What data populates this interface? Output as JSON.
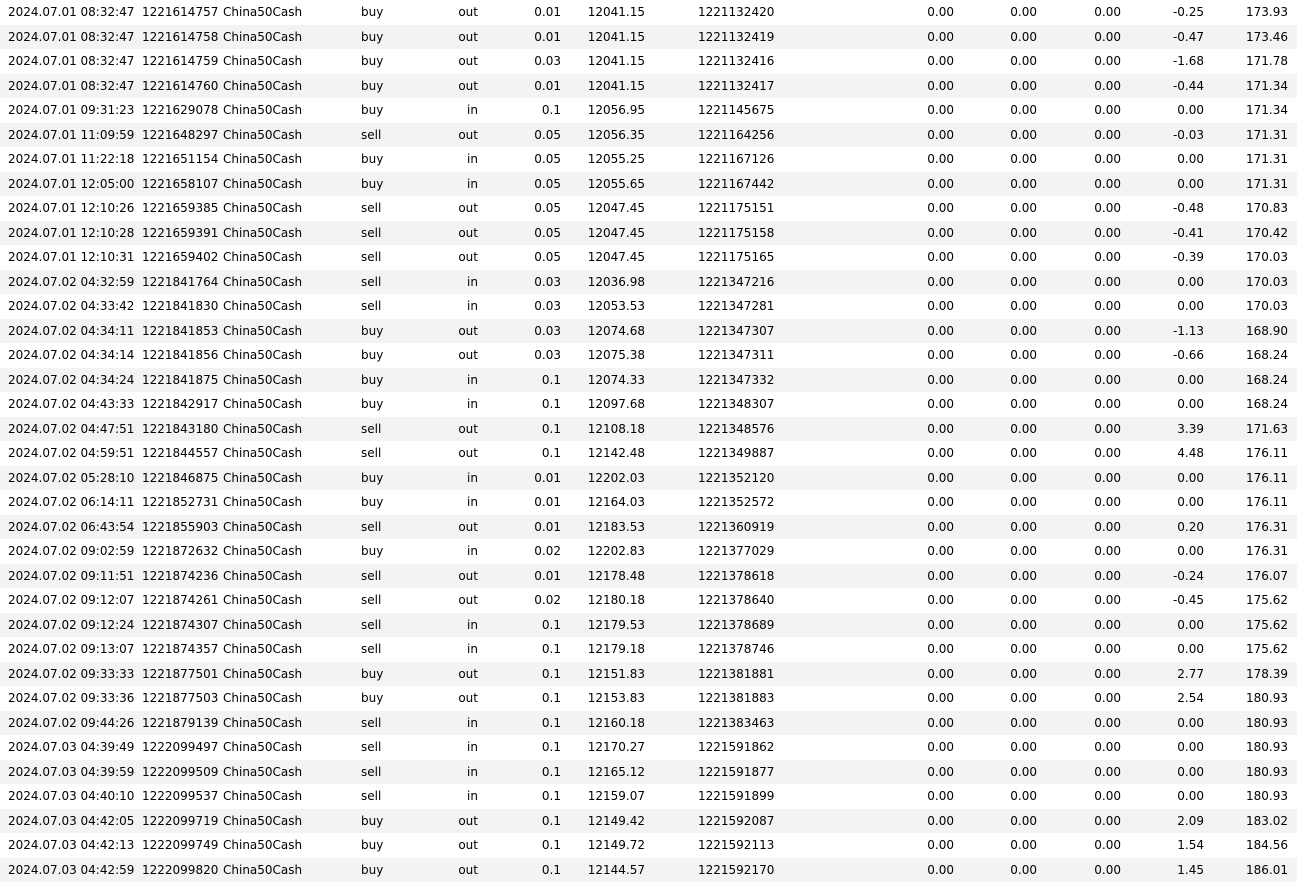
{
  "table": {
    "rows": [
      {
        "time": "2024.07.01 08:32:47",
        "deal": "1221614757",
        "symbol": "China50Cash",
        "type": "buy",
        "direction": "out",
        "volume": "0.01",
        "price": "12041.15",
        "order": "1221132420",
        "commission": "0.00",
        "fee": "0.00",
        "swap": "0.00",
        "profit": "-0.25",
        "balance": "173.93"
      },
      {
        "time": "2024.07.01 08:32:47",
        "deal": "1221614758",
        "symbol": "China50Cash",
        "type": "buy",
        "direction": "out",
        "volume": "0.01",
        "price": "12041.15",
        "order": "1221132419",
        "commission": "0.00",
        "fee": "0.00",
        "swap": "0.00",
        "profit": "-0.47",
        "balance": "173.46"
      },
      {
        "time": "2024.07.01 08:32:47",
        "deal": "1221614759",
        "symbol": "China50Cash",
        "type": "buy",
        "direction": "out",
        "volume": "0.03",
        "price": "12041.15",
        "order": "1221132416",
        "commission": "0.00",
        "fee": "0.00",
        "swap": "0.00",
        "profit": "-1.68",
        "balance": "171.78"
      },
      {
        "time": "2024.07.01 08:32:47",
        "deal": "1221614760",
        "symbol": "China50Cash",
        "type": "buy",
        "direction": "out",
        "volume": "0.01",
        "price": "12041.15",
        "order": "1221132417",
        "commission": "0.00",
        "fee": "0.00",
        "swap": "0.00",
        "profit": "-0.44",
        "balance": "171.34"
      },
      {
        "time": "2024.07.01 09:31:23",
        "deal": "1221629078",
        "symbol": "China50Cash",
        "type": "buy",
        "direction": "in",
        "volume": "0.1",
        "price": "12056.95",
        "order": "1221145675",
        "commission": "0.00",
        "fee": "0.00",
        "swap": "0.00",
        "profit": "0.00",
        "balance": "171.34"
      },
      {
        "time": "2024.07.01 11:09:59",
        "deal": "1221648297",
        "symbol": "China50Cash",
        "type": "sell",
        "direction": "out",
        "volume": "0.05",
        "price": "12056.35",
        "order": "1221164256",
        "commission": "0.00",
        "fee": "0.00",
        "swap": "0.00",
        "profit": "-0.03",
        "balance": "171.31"
      },
      {
        "time": "2024.07.01 11:22:18",
        "deal": "1221651154",
        "symbol": "China50Cash",
        "type": "buy",
        "direction": "in",
        "volume": "0.05",
        "price": "12055.25",
        "order": "1221167126",
        "commission": "0.00",
        "fee": "0.00",
        "swap": "0.00",
        "profit": "0.00",
        "balance": "171.31"
      },
      {
        "time": "2024.07.01 12:05:00",
        "deal": "1221658107",
        "symbol": "China50Cash",
        "type": "buy",
        "direction": "in",
        "volume": "0.05",
        "price": "12055.65",
        "order": "1221167442",
        "commission": "0.00",
        "fee": "0.00",
        "swap": "0.00",
        "profit": "0.00",
        "balance": "171.31"
      },
      {
        "time": "2024.07.01 12:10:26",
        "deal": "1221659385",
        "symbol": "China50Cash",
        "type": "sell",
        "direction": "out",
        "volume": "0.05",
        "price": "12047.45",
        "order": "1221175151",
        "commission": "0.00",
        "fee": "0.00",
        "swap": "0.00",
        "profit": "-0.48",
        "balance": "170.83"
      },
      {
        "time": "2024.07.01 12:10:28",
        "deal": "1221659391",
        "symbol": "China50Cash",
        "type": "sell",
        "direction": "out",
        "volume": "0.05",
        "price": "12047.45",
        "order": "1221175158",
        "commission": "0.00",
        "fee": "0.00",
        "swap": "0.00",
        "profit": "-0.41",
        "balance": "170.42"
      },
      {
        "time": "2024.07.01 12:10:31",
        "deal": "1221659402",
        "symbol": "China50Cash",
        "type": "sell",
        "direction": "out",
        "volume": "0.05",
        "price": "12047.45",
        "order": "1221175165",
        "commission": "0.00",
        "fee": "0.00",
        "swap": "0.00",
        "profit": "-0.39",
        "balance": "170.03"
      },
      {
        "time": "2024.07.02 04:32:59",
        "deal": "1221841764",
        "symbol": "China50Cash",
        "type": "sell",
        "direction": "in",
        "volume": "0.03",
        "price": "12036.98",
        "order": "1221347216",
        "commission": "0.00",
        "fee": "0.00",
        "swap": "0.00",
        "profit": "0.00",
        "balance": "170.03"
      },
      {
        "time": "2024.07.02 04:33:42",
        "deal": "1221841830",
        "symbol": "China50Cash",
        "type": "sell",
        "direction": "in",
        "volume": "0.03",
        "price": "12053.53",
        "order": "1221347281",
        "commission": "0.00",
        "fee": "0.00",
        "swap": "0.00",
        "profit": "0.00",
        "balance": "170.03"
      },
      {
        "time": "2024.07.02 04:34:11",
        "deal": "1221841853",
        "symbol": "China50Cash",
        "type": "buy",
        "direction": "out",
        "volume": "0.03",
        "price": "12074.68",
        "order": "1221347307",
        "commission": "0.00",
        "fee": "0.00",
        "swap": "0.00",
        "profit": "-1.13",
        "balance": "168.90"
      },
      {
        "time": "2024.07.02 04:34:14",
        "deal": "1221841856",
        "symbol": "China50Cash",
        "type": "buy",
        "direction": "out",
        "volume": "0.03",
        "price": "12075.38",
        "order": "1221347311",
        "commission": "0.00",
        "fee": "0.00",
        "swap": "0.00",
        "profit": "-0.66",
        "balance": "168.24"
      },
      {
        "time": "2024.07.02 04:34:24",
        "deal": "1221841875",
        "symbol": "China50Cash",
        "type": "buy",
        "direction": "in",
        "volume": "0.1",
        "price": "12074.33",
        "order": "1221347332",
        "commission": "0.00",
        "fee": "0.00",
        "swap": "0.00",
        "profit": "0.00",
        "balance": "168.24"
      },
      {
        "time": "2024.07.02 04:43:33",
        "deal": "1221842917",
        "symbol": "China50Cash",
        "type": "buy",
        "direction": "in",
        "volume": "0.1",
        "price": "12097.68",
        "order": "1221348307",
        "commission": "0.00",
        "fee": "0.00",
        "swap": "0.00",
        "profit": "0.00",
        "balance": "168.24"
      },
      {
        "time": "2024.07.02 04:47:51",
        "deal": "1221843180",
        "symbol": "China50Cash",
        "type": "sell",
        "direction": "out",
        "volume": "0.1",
        "price": "12108.18",
        "order": "1221348576",
        "commission": "0.00",
        "fee": "0.00",
        "swap": "0.00",
        "profit": "3.39",
        "balance": "171.63"
      },
      {
        "time": "2024.07.02 04:59:51",
        "deal": "1221844557",
        "symbol": "China50Cash",
        "type": "sell",
        "direction": "out",
        "volume": "0.1",
        "price": "12142.48",
        "order": "1221349887",
        "commission": "0.00",
        "fee": "0.00",
        "swap": "0.00",
        "profit": "4.48",
        "balance": "176.11"
      },
      {
        "time": "2024.07.02 05:28:10",
        "deal": "1221846875",
        "symbol": "China50Cash",
        "type": "buy",
        "direction": "in",
        "volume": "0.01",
        "price": "12202.03",
        "order": "1221352120",
        "commission": "0.00",
        "fee": "0.00",
        "swap": "0.00",
        "profit": "0.00",
        "balance": "176.11"
      },
      {
        "time": "2024.07.02 06:14:11",
        "deal": "1221852731",
        "symbol": "China50Cash",
        "type": "buy",
        "direction": "in",
        "volume": "0.01",
        "price": "12164.03",
        "order": "1221352572",
        "commission": "0.00",
        "fee": "0.00",
        "swap": "0.00",
        "profit": "0.00",
        "balance": "176.11"
      },
      {
        "time": "2024.07.02 06:43:54",
        "deal": "1221855903",
        "symbol": "China50Cash",
        "type": "sell",
        "direction": "out",
        "volume": "0.01",
        "price": "12183.53",
        "order": "1221360919",
        "commission": "0.00",
        "fee": "0.00",
        "swap": "0.00",
        "profit": "0.20",
        "balance": "176.31"
      },
      {
        "time": "2024.07.02 09:02:59",
        "deal": "1221872632",
        "symbol": "China50Cash",
        "type": "buy",
        "direction": "in",
        "volume": "0.02",
        "price": "12202.83",
        "order": "1221377029",
        "commission": "0.00",
        "fee": "0.00",
        "swap": "0.00",
        "profit": "0.00",
        "balance": "176.31"
      },
      {
        "time": "2024.07.02 09:11:51",
        "deal": "1221874236",
        "symbol": "China50Cash",
        "type": "sell",
        "direction": "out",
        "volume": "0.01",
        "price": "12178.48",
        "order": "1221378618",
        "commission": "0.00",
        "fee": "0.00",
        "swap": "0.00",
        "profit": "-0.24",
        "balance": "176.07"
      },
      {
        "time": "2024.07.02 09:12:07",
        "deal": "1221874261",
        "symbol": "China50Cash",
        "type": "sell",
        "direction": "out",
        "volume": "0.02",
        "price": "12180.18",
        "order": "1221378640",
        "commission": "0.00",
        "fee": "0.00",
        "swap": "0.00",
        "profit": "-0.45",
        "balance": "175.62"
      },
      {
        "time": "2024.07.02 09:12:24",
        "deal": "1221874307",
        "symbol": "China50Cash",
        "type": "sell",
        "direction": "in",
        "volume": "0.1",
        "price": "12179.53",
        "order": "1221378689",
        "commission": "0.00",
        "fee": "0.00",
        "swap": "0.00",
        "profit": "0.00",
        "balance": "175.62"
      },
      {
        "time": "2024.07.02 09:13:07",
        "deal": "1221874357",
        "symbol": "China50Cash",
        "type": "sell",
        "direction": "in",
        "volume": "0.1",
        "price": "12179.18",
        "order": "1221378746",
        "commission": "0.00",
        "fee": "0.00",
        "swap": "0.00",
        "profit": "0.00",
        "balance": "175.62"
      },
      {
        "time": "2024.07.02 09:33:33",
        "deal": "1221877501",
        "symbol": "China50Cash",
        "type": "buy",
        "direction": "out",
        "volume": "0.1",
        "price": "12151.83",
        "order": "1221381881",
        "commission": "0.00",
        "fee": "0.00",
        "swap": "0.00",
        "profit": "2.77",
        "balance": "178.39"
      },
      {
        "time": "2024.07.02 09:33:36",
        "deal": "1221877503",
        "symbol": "China50Cash",
        "type": "buy",
        "direction": "out",
        "volume": "0.1",
        "price": "12153.83",
        "order": "1221381883",
        "commission": "0.00",
        "fee": "0.00",
        "swap": "0.00",
        "profit": "2.54",
        "balance": "180.93"
      },
      {
        "time": "2024.07.02 09:44:26",
        "deal": "1221879139",
        "symbol": "China50Cash",
        "type": "sell",
        "direction": "in",
        "volume": "0.1",
        "price": "12160.18",
        "order": "1221383463",
        "commission": "0.00",
        "fee": "0.00",
        "swap": "0.00",
        "profit": "0.00",
        "balance": "180.93"
      },
      {
        "time": "2024.07.03 04:39:49",
        "deal": "1222099497",
        "symbol": "China50Cash",
        "type": "sell",
        "direction": "in",
        "volume": "0.1",
        "price": "12170.27",
        "order": "1221591862",
        "commission": "0.00",
        "fee": "0.00",
        "swap": "0.00",
        "profit": "0.00",
        "balance": "180.93"
      },
      {
        "time": "2024.07.03 04:39:59",
        "deal": "1222099509",
        "symbol": "China50Cash",
        "type": "sell",
        "direction": "in",
        "volume": "0.1",
        "price": "12165.12",
        "order": "1221591877",
        "commission": "0.00",
        "fee": "0.00",
        "swap": "0.00",
        "profit": "0.00",
        "balance": "180.93"
      },
      {
        "time": "2024.07.03 04:40:10",
        "deal": "1222099537",
        "symbol": "China50Cash",
        "type": "sell",
        "direction": "in",
        "volume": "0.1",
        "price": "12159.07",
        "order": "1221591899",
        "commission": "0.00",
        "fee": "0.00",
        "swap": "0.00",
        "profit": "0.00",
        "balance": "180.93"
      },
      {
        "time": "2024.07.03 04:42:05",
        "deal": "1222099719",
        "symbol": "China50Cash",
        "type": "buy",
        "direction": "out",
        "volume": "0.1",
        "price": "12149.42",
        "order": "1221592087",
        "commission": "0.00",
        "fee": "0.00",
        "swap": "0.00",
        "profit": "2.09",
        "balance": "183.02"
      },
      {
        "time": "2024.07.03 04:42:13",
        "deal": "1222099749",
        "symbol": "China50Cash",
        "type": "buy",
        "direction": "out",
        "volume": "0.1",
        "price": "12149.72",
        "order": "1221592113",
        "commission": "0.00",
        "fee": "0.00",
        "swap": "0.00",
        "profit": "1.54",
        "balance": "184.56"
      },
      {
        "time": "2024.07.03 04:42:59",
        "deal": "1222099820",
        "symbol": "China50Cash",
        "type": "buy",
        "direction": "out",
        "volume": "0.1",
        "price": "12144.57",
        "order": "1221592170",
        "commission": "0.00",
        "fee": "0.00",
        "swap": "0.00",
        "profit": "1.45",
        "balance": "186.01"
      }
    ]
  },
  "colors": {
    "alt_row_background": "#f3f3f3",
    "row_background": "#ffffff",
    "text": "#000000"
  }
}
